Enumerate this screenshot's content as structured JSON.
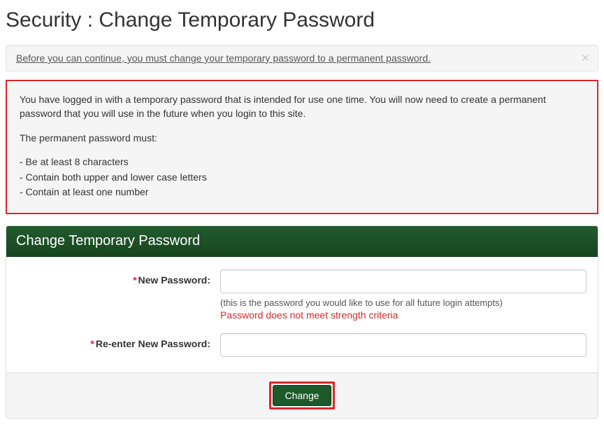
{
  "page": {
    "title": "Security : Change Temporary Password"
  },
  "alert": {
    "text": "Before you can continue, you must change your temporary password to a permanent password.",
    "close_glyph": "×"
  },
  "info": {
    "intro": "You have logged in with a temporary password that is intended for use one time. You will now need to create a permanent password that you will use in the future when you login to this site.",
    "must_label": "The permanent password must:",
    "req1": "- Be at least 8 characters",
    "req2": "- Contain both upper and lower case letters",
    "req3": "- Contain at least one number"
  },
  "panel": {
    "title": "Change Temporary Password"
  },
  "form": {
    "required_mark": "*",
    "new_password": {
      "label": "New Password:",
      "value": "",
      "hint": "(this is the password you would like to use for all future login attempts)",
      "error": "Password does not meet strength criteria"
    },
    "reenter_password": {
      "label": "Re-enter New Password:",
      "value": ""
    },
    "submit_label": "Change"
  }
}
